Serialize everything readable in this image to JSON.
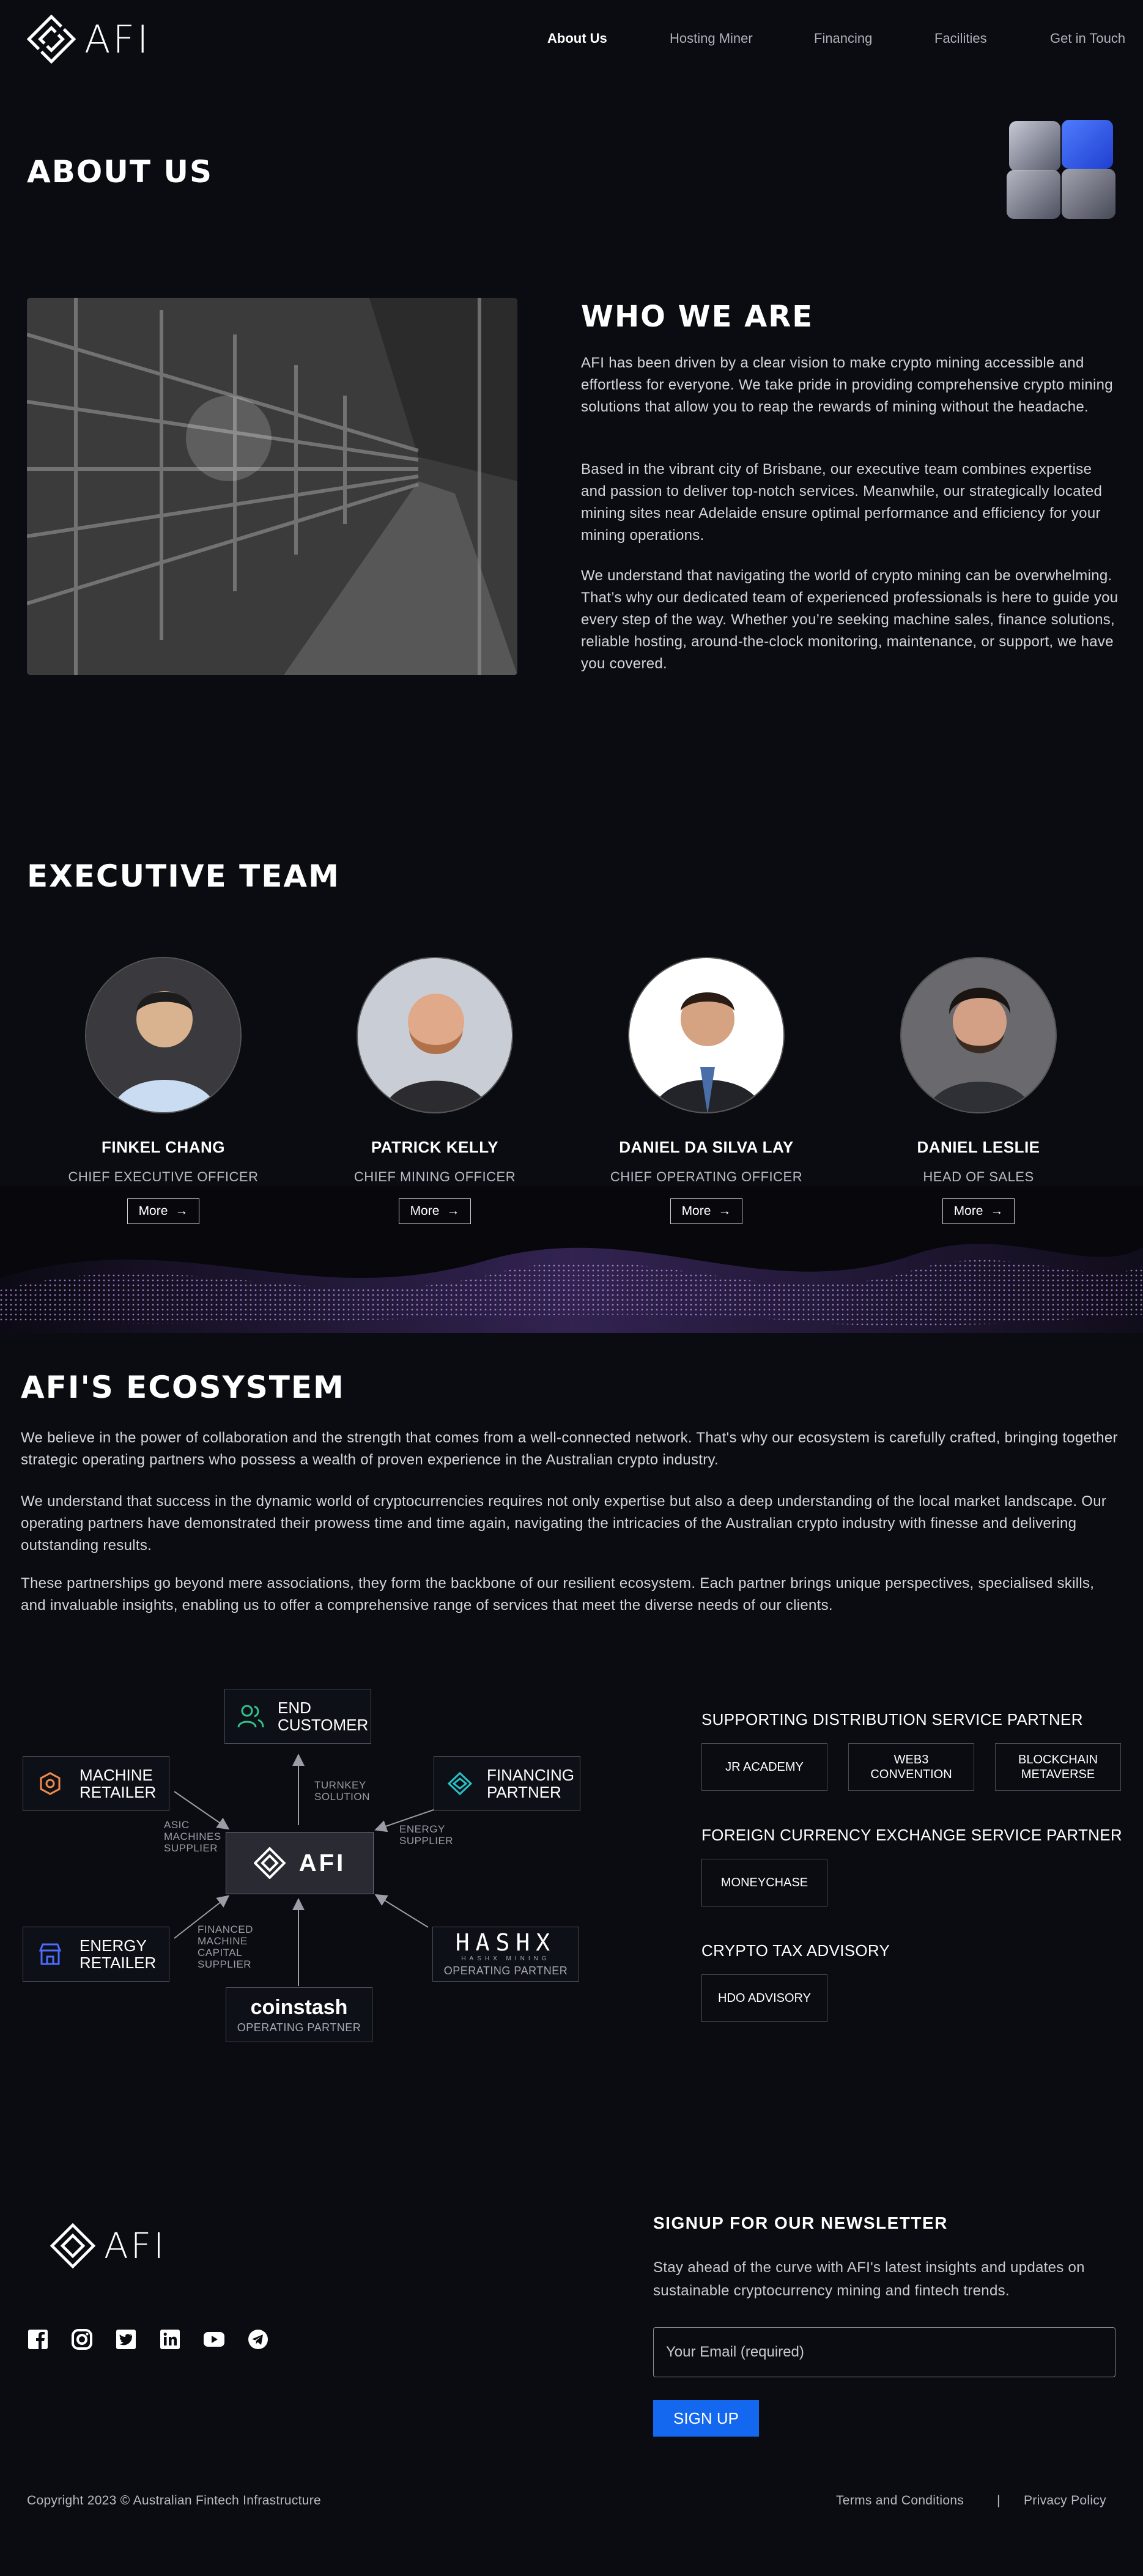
{
  "brand": {
    "name": "AFI"
  },
  "nav": {
    "items": [
      {
        "label": "About Us",
        "active": true
      },
      {
        "label": "Hosting Miner"
      },
      {
        "label": "Financing"
      },
      {
        "label": "Facilities"
      },
      {
        "label": "Get in Touch"
      }
    ]
  },
  "about": {
    "title": "ABOUT US",
    "who_title": "WHO WE ARE",
    "paragraphs": [
      "AFI has been driven by a clear vision to make crypto mining accessible and effortless for everyone. We take pride in providing comprehensive crypto mining solutions that allow you to reap the rewards of mining without the headache.",
      "Based in the vibrant city of Brisbane, our executive team combines expertise and passion to deliver top-notch services. Meanwhile, our strategically located mining sites near Adelaide ensure optimal performance and efficiency for your mining operations.",
      "We understand that navigating the world of crypto mining can be overwhelming. That’s why our dedicated team of experienced professionals is here to guide you every step of the way. Whether you’re seeking machine sales, finance solutions, reliable hosting, around-the-clock monitoring, maintenance, or support, we have you covered."
    ]
  },
  "team": {
    "title": "EXECUTIVE TEAM",
    "more_label": "More",
    "members": [
      {
        "name": "FINKEL CHANG",
        "role": "CHIEF EXECUTIVE OFFICER"
      },
      {
        "name": "PATRICK KELLY",
        "role": "CHIEF MINING OFFICER"
      },
      {
        "name": "DANIEL DA SILVA LAY",
        "role": "CHIEF OPERATING OFFICER"
      },
      {
        "name": "DANIEL LESLIE",
        "role": "HEAD OF SALES"
      }
    ]
  },
  "ecosystem": {
    "title": "AFI'S ECOSYSTEM",
    "paragraphs": [
      "We believe in the power of collaboration and the strength that comes from a well-connected network. That's why our ecosystem is carefully crafted, bringing together strategic operating partners who possess a wealth of proven experience in the Australian crypto industry.",
      "We understand that success in the dynamic world of cryptocurrencies requires not only expertise but also a deep understanding of the local market landscape. Our operating partners have demonstrated their prowess time and time again, navigating the intricacies of the Australian crypto industry with finesse and delivering outstanding results.",
      "These partnerships go beyond mere associations, they form the backbone of our resilient ecosystem. Each partner brings unique perspectives, specialised skills, and invaluable insights, enabling us to offer a comprehensive range of services that meet the diverse needs of our clients."
    ],
    "diagram": {
      "center": "AFI",
      "end_customer": [
        "END",
        "CUSTOMER"
      ],
      "machine_retailer": [
        "MACHINE",
        "RETAILER"
      ],
      "financing_partner": [
        "FINANCING",
        "PARTNER"
      ],
      "energy_retailer": [
        "ENERGY",
        "RETAILER"
      ],
      "hashx_logo": "HASHX",
      "hashx_tagline": "HASHX  MINING",
      "hashx_role": "OPERATING PARTNER",
      "coinstash_logo": "coinstash",
      "coinstash_role": "OPERATING PARTNER",
      "note_turnkey": [
        "TURNKEY",
        "SOLUTION"
      ],
      "note_asic": [
        "ASIC",
        "MACHINES",
        "SUPPLIER"
      ],
      "note_energy": [
        "ENERGY",
        "SUPPLIER"
      ],
      "note_financed": [
        "FINANCED",
        "MACHINE",
        "CAPITAL",
        "SUPPLIER"
      ]
    },
    "partner_groups": [
      {
        "title": "SUPPORTING DISTRIBUTION SERVICE PARTNER",
        "partners": [
          [
            "JR ACADEMY"
          ],
          [
            "WEB3",
            "CONVENTION"
          ],
          [
            "BLOCKCHAIN",
            "METAVERSE"
          ]
        ]
      },
      {
        "title": "FOREIGN CURRENCY EXCHANGE SERVICE PARTNER",
        "partners": [
          [
            "MONEYCHASE"
          ]
        ]
      },
      {
        "title": "CRYPTO TAX ADVISORY",
        "partners": [
          [
            "HDO ADVISORY"
          ]
        ]
      }
    ]
  },
  "footer": {
    "newsletter_title": "SIGNUP FOR OUR NEWSLETTER",
    "newsletter_text": "Stay ahead of the curve with AFI's latest insights and updates on sustainable cryptocurrency mining and fintech trends.",
    "email_placeholder": "Your Email (required)",
    "signup_label": "SIGN UP",
    "copyright": "Copyright 2023 © Australian Fintech Infrastructure",
    "terms": "Terms and Conditions",
    "separator": "|",
    "privacy": "Privacy Policy",
    "social": [
      "facebook-icon",
      "instagram-icon",
      "twitter-icon",
      "linkedin-icon",
      "youtube-icon",
      "telegram-icon"
    ]
  },
  "colors": {
    "background": "#0b0c12",
    "accent_blue": "#1468f0",
    "cube_blue": "#2f5cf0",
    "wave_purple": "#8f5fe6"
  }
}
